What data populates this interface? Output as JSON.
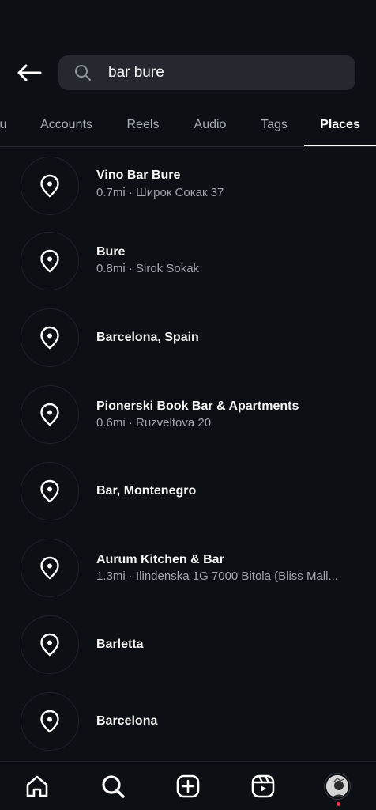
{
  "search": {
    "value": "bar bure"
  },
  "tabs": [
    {
      "label": "u"
    },
    {
      "label": "Accounts"
    },
    {
      "label": "Reels"
    },
    {
      "label": "Audio"
    },
    {
      "label": "Tags"
    },
    {
      "label": "Places"
    }
  ],
  "active_tab": "Places",
  "places": [
    {
      "name": "Vino Bar Bure",
      "sub": "0.7mi · Широк Сокак 37"
    },
    {
      "name": "Bure",
      "sub": "0.8mi · Sirok Sokak"
    },
    {
      "name": "Barcelona, Spain",
      "sub": ""
    },
    {
      "name": "Pionerski Book Bar & Apartments",
      "sub": "0.6mi · Ruzveltova 20"
    },
    {
      "name": "Bar, Montenegro",
      "sub": ""
    },
    {
      "name": "Aurum Kitchen & Bar",
      "sub": "1.3mi · Ilindenska 1G 7000 Bitola (Bliss Mall..."
    },
    {
      "name": "Barletta",
      "sub": ""
    },
    {
      "name": "Barcelona",
      "sub": ""
    }
  ],
  "icons": {
    "back": "arrow-left-icon",
    "search": "search-icon",
    "place": "location-pin-icon",
    "nav_home": "home-icon",
    "nav_search": "search-icon",
    "nav_create": "plus-square-icon",
    "nav_reels": "reels-icon",
    "nav_profile": "avatar"
  },
  "colors": {
    "background": "#0c0f14",
    "search_bg": "#25292f",
    "text_primary": "#f5f5f5",
    "text_secondary": "#a3a7ad",
    "notification_dot": "#ff3040"
  }
}
